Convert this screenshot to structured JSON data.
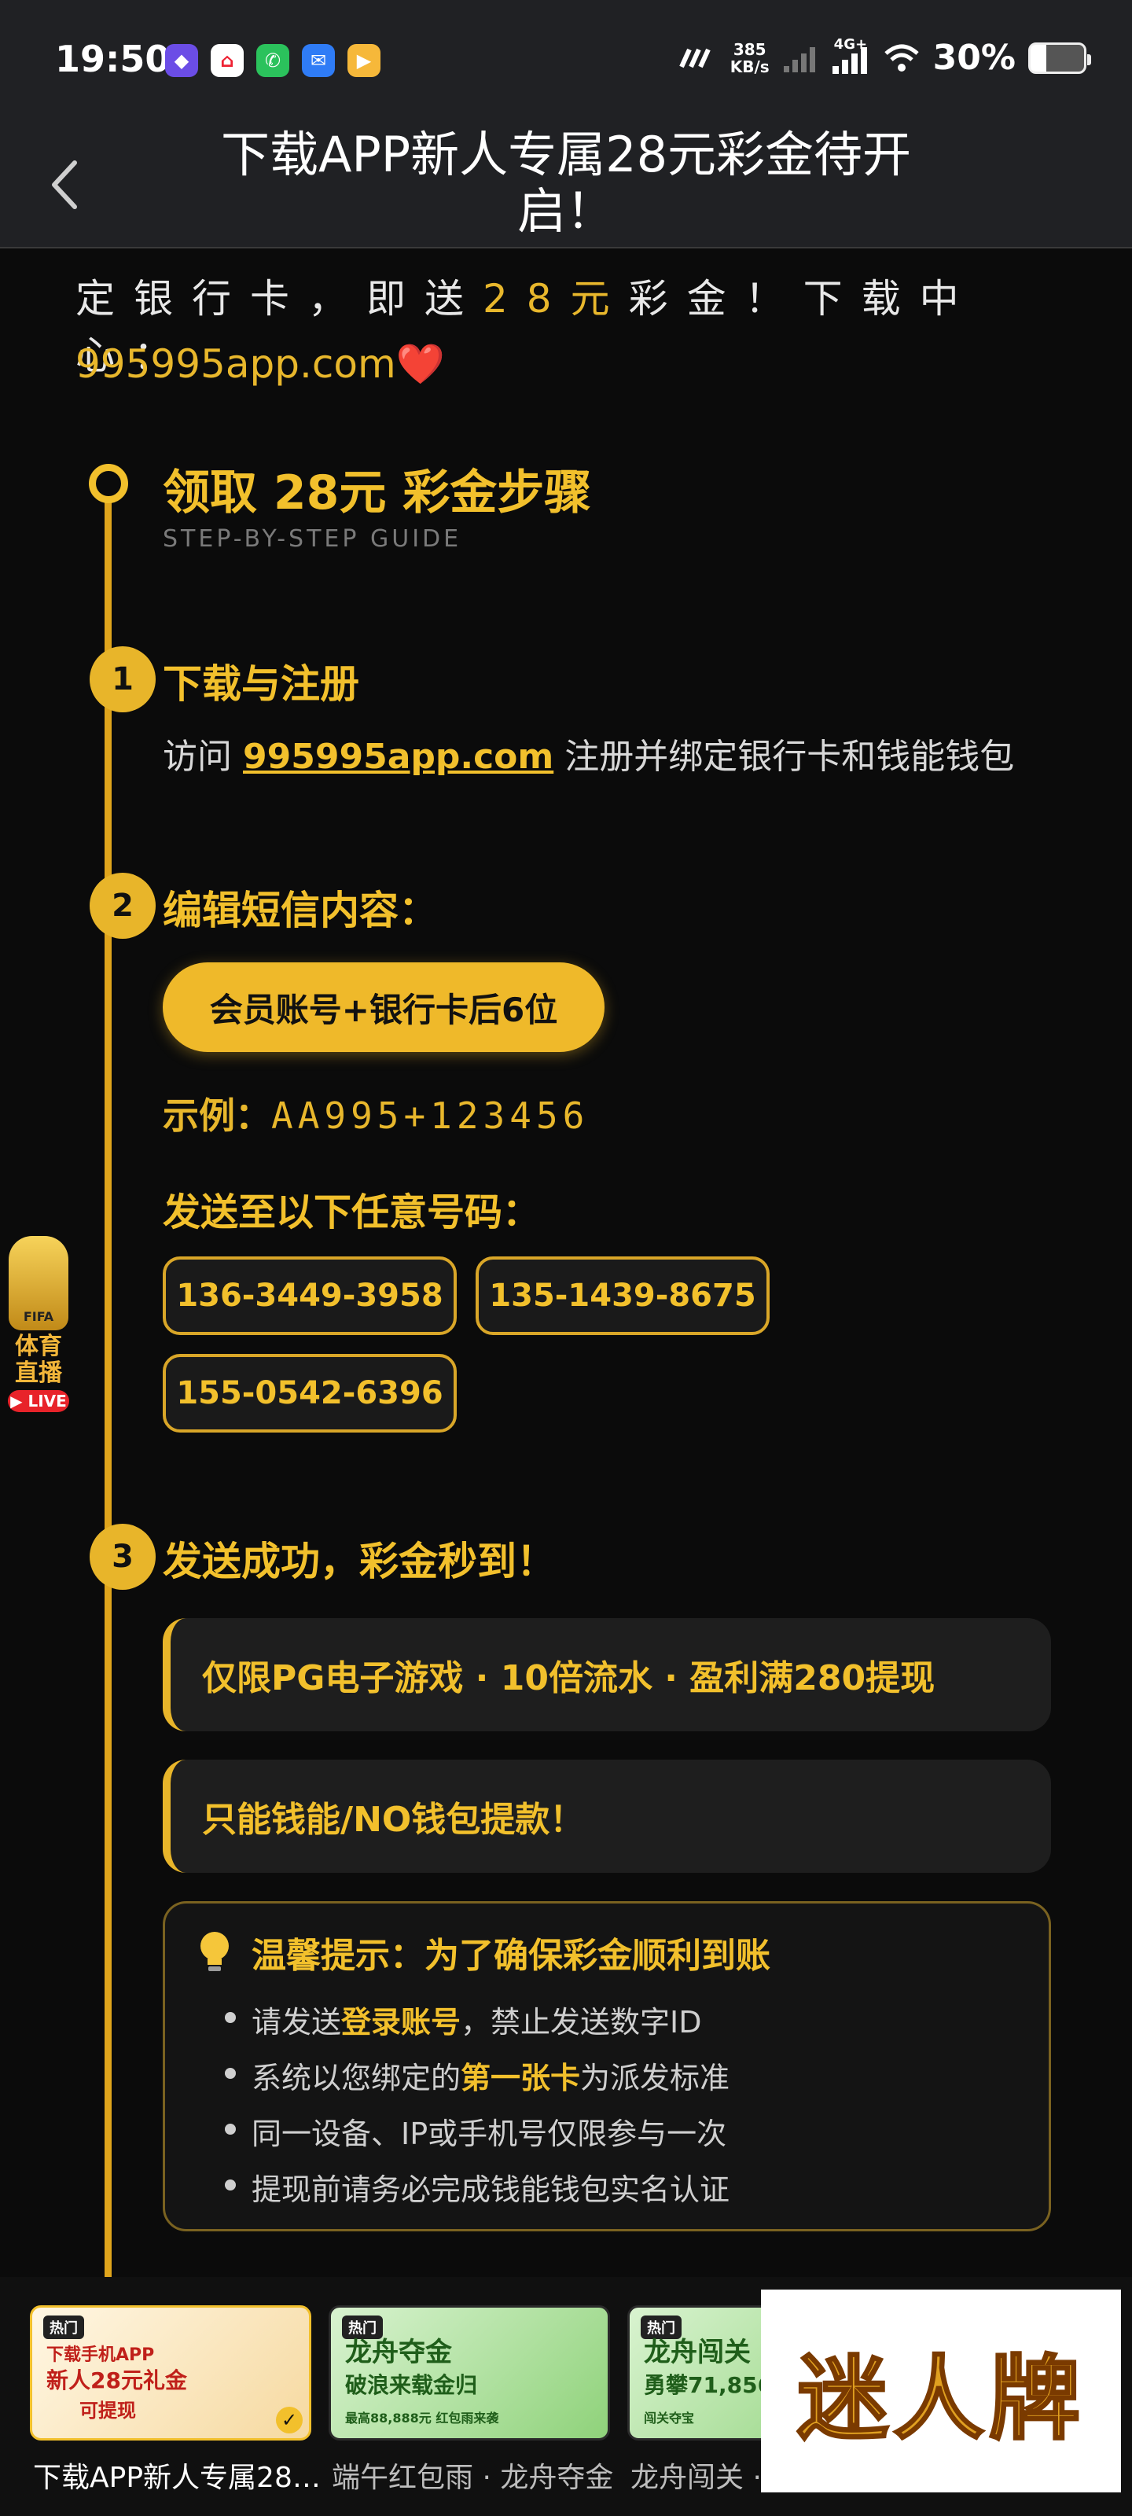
{
  "status_bar": {
    "time": "19:50",
    "net_speed_value": "385",
    "net_speed_unit": "KB/s",
    "cellular": "4G+",
    "battery": "30%",
    "battery_level": 0.3
  },
  "header": {
    "title": "下载APP新人专属28元彩金待开启！"
  },
  "intro": {
    "line_prefix": "定银行卡，即送",
    "line_amount": "28元",
    "line_suffix": "彩金！下载中心：",
    "link": "995995app.com",
    "heart": "❤️"
  },
  "guide": {
    "title": "领取 28元 彩金步骤",
    "subtitle": "STEP-BY-STEP GUIDE"
  },
  "steps": [
    {
      "number": "1",
      "title": "下载与注册",
      "text_prefix": "访问",
      "link": "995995app.com",
      "text_suffix": "注册并绑定银行卡和钱能钱包"
    },
    {
      "number": "2",
      "title": "编辑短信内容：",
      "pill": "会员账号+银行卡后6位",
      "example_label": "示例：",
      "example_code": "AA995+123456",
      "send_to": "发送至以下任意号码：",
      "phones": [
        "136-3449-3958",
        "135-1439-8675",
        "155-0542-6396"
      ]
    },
    {
      "number": "3",
      "title": "发送成功，彩金秒到！",
      "notes": [
        "仅限PG电子游戏 · 10倍流水 · 盈利满280提现",
        "只能钱能/NO钱包提款！"
      ]
    }
  ],
  "tip": {
    "title": "温馨提示：为了确保彩金顺利到账",
    "items": [
      {
        "pre": "请发送",
        "bold": "登录账号",
        "post": "，禁止发送数字ID"
      },
      {
        "pre": "系统以您绑定的",
        "bold": "第一张卡",
        "post": "为派发标准"
      },
      {
        "pre": "同一设备、IP或手机号仅限参与一次",
        "bold": "",
        "post": ""
      },
      {
        "pre": "提现前请务必完成钱能钱包实名认证",
        "bold": "",
        "post": ""
      }
    ]
  },
  "fifa_badge": {
    "cup_label": "FIFA",
    "line1": "体育",
    "line2": "直播",
    "live": "LIVE"
  },
  "bottom_cards": [
    {
      "hot": "热门",
      "main_l1": "下载手机APP",
      "main_l2": "新人28元礼金",
      "main_l3": "可提现",
      "label": "下载APP新人专属28…",
      "active": true
    },
    {
      "hot": "热门",
      "main_l1": "龙舟夺金",
      "main_l2": "破浪来载金归",
      "main_l3": "最高88,888元 红包雨来袭",
      "label": "端午红包雨 · 龙舟夺金",
      "active": false
    },
    {
      "hot": "热门",
      "main_l1": "龙舟闯关",
      "main_l2": "勇攀71,856",
      "main_l3": "闯关夺宝",
      "label": "龙舟闯关 ·",
      "active": false
    }
  ],
  "watermark": {
    "text": "迷人牌"
  },
  "colors": {
    "accent": "#f2c02c",
    "background": "#0b0b0b",
    "bar": "#202124"
  }
}
